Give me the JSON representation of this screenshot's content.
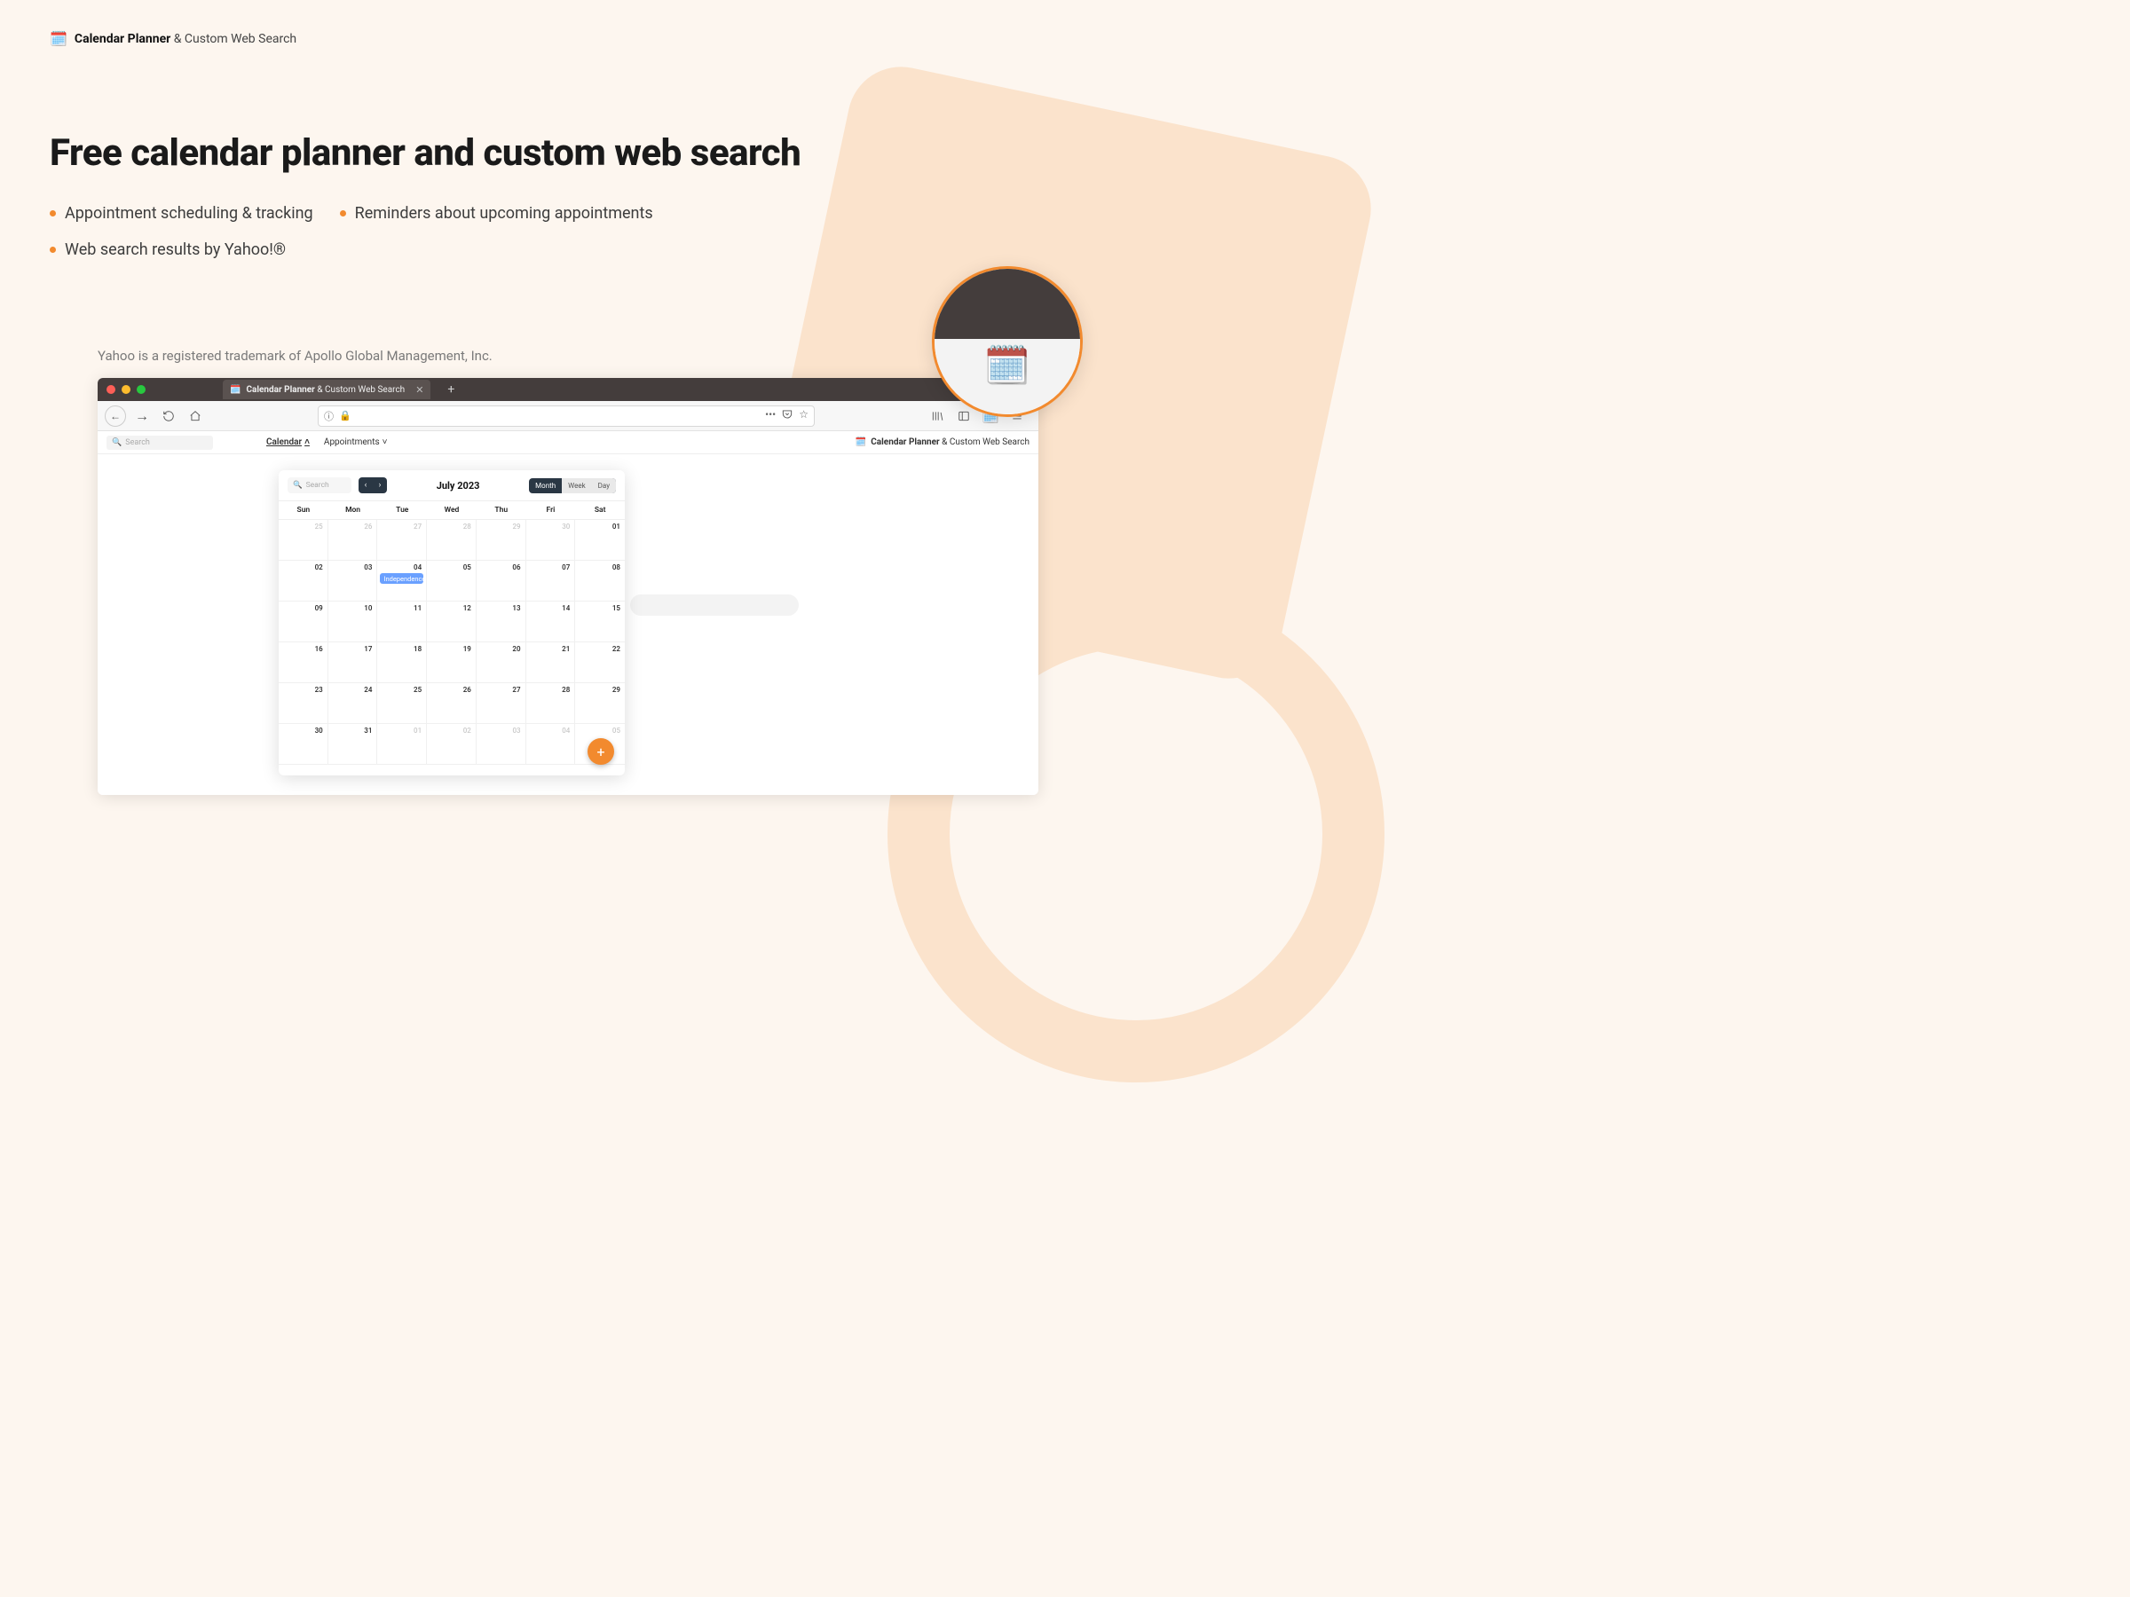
{
  "brand": {
    "icon": "🗓️",
    "strong": "Calendar Planner",
    "light": " & Custom Web Search"
  },
  "headline": "Free calendar planner and custom web search",
  "bullets": [
    "Appointment scheduling & tracking",
    "Reminders about upcoming appointments",
    "Web search results by Yahoo!®"
  ],
  "trademark": "Yahoo is a registered trademark of Apollo Global Management, Inc.",
  "browser": {
    "tab": {
      "icon": "🗓️",
      "title_strong": "Calendar Planner",
      "title_light": " & Custom Web Search"
    },
    "url_info_icon": "ⓘ",
    "url_dots": "•••",
    "subbar": {
      "search_placeholder": "Search",
      "tabs": [
        {
          "label": "Calendar",
          "caret": "˄",
          "active": true
        },
        {
          "label": "Appointments",
          "caret": "˅",
          "active": false
        }
      ],
      "right_icon": "🗓️",
      "right_strong": "Calendar Planner",
      "right_light": " & Custom Web Search"
    }
  },
  "calendar": {
    "search_placeholder": "Search",
    "month_label": "July 2023",
    "views": {
      "month": "Month",
      "week": "Week",
      "day": "Day"
    },
    "dow": [
      "Sun",
      "Mon",
      "Tue",
      "Wed",
      "Thu",
      "Fri",
      "Sat"
    ],
    "weeks": [
      [
        {
          "n": "25",
          "out": true
        },
        {
          "n": "26",
          "out": true
        },
        {
          "n": "27",
          "out": true
        },
        {
          "n": "28",
          "out": true
        },
        {
          "n": "29",
          "out": true
        },
        {
          "n": "30",
          "out": true
        },
        {
          "n": "01"
        }
      ],
      [
        {
          "n": "02"
        },
        {
          "n": "03"
        },
        {
          "n": "04",
          "event": "Independence …"
        },
        {
          "n": "05"
        },
        {
          "n": "06"
        },
        {
          "n": "07"
        },
        {
          "n": "08"
        }
      ],
      [
        {
          "n": "09"
        },
        {
          "n": "10"
        },
        {
          "n": "11"
        },
        {
          "n": "12"
        },
        {
          "n": "13"
        },
        {
          "n": "14"
        },
        {
          "n": "15"
        }
      ],
      [
        {
          "n": "16"
        },
        {
          "n": "17"
        },
        {
          "n": "18"
        },
        {
          "n": "19"
        },
        {
          "n": "20"
        },
        {
          "n": "21"
        },
        {
          "n": "22"
        }
      ],
      [
        {
          "n": "23"
        },
        {
          "n": "24"
        },
        {
          "n": "25"
        },
        {
          "n": "26"
        },
        {
          "n": "27"
        },
        {
          "n": "28"
        },
        {
          "n": "29"
        }
      ],
      [
        {
          "n": "30"
        },
        {
          "n": "31"
        },
        {
          "n": "01",
          "out": true
        },
        {
          "n": "02",
          "out": true
        },
        {
          "n": "03",
          "out": true
        },
        {
          "n": "04",
          "out": true
        },
        {
          "n": "05",
          "out": true
        }
      ]
    ],
    "fab": "+"
  },
  "hero_icon": "🗓️"
}
